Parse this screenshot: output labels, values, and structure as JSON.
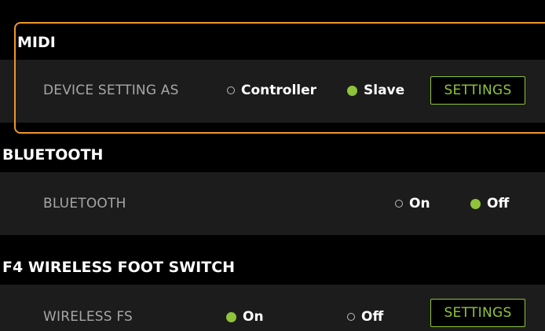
{
  "midi": {
    "title": "MIDI",
    "label": "DEVICE SETTING AS",
    "options": [
      {
        "label": "Controller",
        "selected": false
      },
      {
        "label": "Slave",
        "selected": true
      }
    ],
    "settings_label": "SETTINGS"
  },
  "bluetooth": {
    "title": "BLUETOOTH",
    "label": "BLUETOOTH",
    "options": [
      {
        "label": "On",
        "selected": false
      },
      {
        "label": "Off",
        "selected": true
      }
    ]
  },
  "f4": {
    "title": "F4 WIRELESS FOOT SWITCH",
    "label": "WIRELESS FS",
    "options": [
      {
        "label": "On",
        "selected": true
      },
      {
        "label": "Off",
        "selected": false
      }
    ],
    "settings_label": "SETTINGS"
  },
  "colors": {
    "accent": "#8fc33a",
    "highlight": "#f0962a",
    "row_bg": "#1c1c1c",
    "header_bg": "#000000",
    "label_gray": "#a6a6a6"
  }
}
